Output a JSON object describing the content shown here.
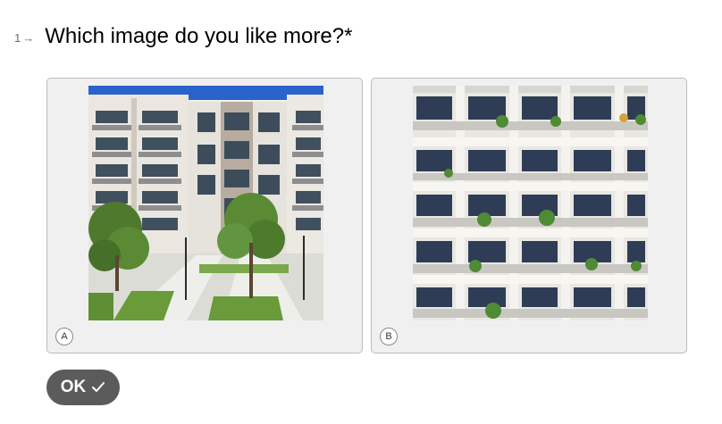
{
  "question": {
    "number": "1",
    "text": "Which image do you like more?",
    "required_marker": "*"
  },
  "choices": [
    {
      "key": "A",
      "image_description": "apartment-building-courtyard"
    },
    {
      "key": "B",
      "image_description": "apartment-facade-balconies"
    }
  ],
  "ok_button": {
    "label": "OK"
  },
  "colors": {
    "card_bg": "#f0f0f0",
    "card_border": "#bdbdbd",
    "button_bg": "#5b5b5b",
    "sky": "#2a63c9"
  }
}
